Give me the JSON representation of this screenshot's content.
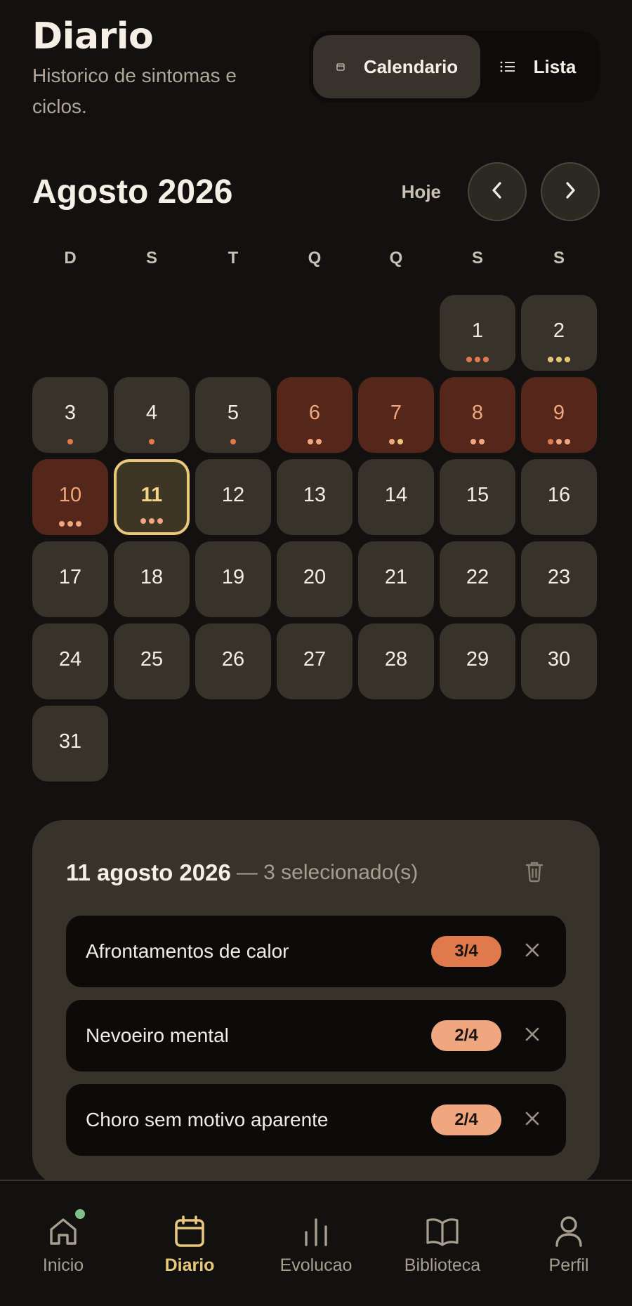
{
  "header": {
    "title": "Diario",
    "subtitle": "Historico de sintomas e ciclos."
  },
  "view_toggle": {
    "calendar_label": "Calendario",
    "list_label": "Lista",
    "active": "calendar"
  },
  "month_nav": {
    "title": "Agosto 2026",
    "today_label": "Hoje"
  },
  "weekdays": [
    "D",
    "S",
    "T",
    "Q",
    "Q",
    "S",
    "S"
  ],
  "colors": {
    "dot_orange": "#e07a4d",
    "dot_yellow": "#e9c77b",
    "dot_peach": "#f0a77f",
    "period_bg": "#54271a",
    "selected_border": "#e9c77b"
  },
  "calendar": {
    "leading_empty": 5,
    "days": [
      {
        "n": 1,
        "type": "normal",
        "dots": [
          "orange",
          "orange",
          "orange"
        ]
      },
      {
        "n": 2,
        "type": "normal",
        "dots": [
          "yellow",
          "yellow",
          "yellow"
        ]
      },
      {
        "n": 3,
        "type": "normal",
        "dots": [
          "orange"
        ]
      },
      {
        "n": 4,
        "type": "normal",
        "dots": [
          "orange"
        ]
      },
      {
        "n": 5,
        "type": "normal",
        "dots": [
          "orange"
        ]
      },
      {
        "n": 6,
        "type": "period",
        "dots": [
          "peach",
          "peach"
        ]
      },
      {
        "n": 7,
        "type": "period",
        "dots": [
          "peach",
          "yellow"
        ]
      },
      {
        "n": 8,
        "type": "period",
        "dots": [
          "peach",
          "peach"
        ]
      },
      {
        "n": 9,
        "type": "period",
        "dots": [
          "orange",
          "peach",
          "peach"
        ]
      },
      {
        "n": 10,
        "type": "period",
        "dots": [
          "peach",
          "peach",
          "peach"
        ]
      },
      {
        "n": 11,
        "type": "selected",
        "dots": [
          "peach",
          "peach",
          "peach"
        ]
      },
      {
        "n": 12,
        "type": "normal",
        "dots": []
      },
      {
        "n": 13,
        "type": "normal",
        "dots": []
      },
      {
        "n": 14,
        "type": "normal",
        "dots": []
      },
      {
        "n": 15,
        "type": "normal",
        "dots": []
      },
      {
        "n": 16,
        "type": "normal",
        "dots": []
      },
      {
        "n": 17,
        "type": "normal",
        "dots": []
      },
      {
        "n": 18,
        "type": "normal",
        "dots": []
      },
      {
        "n": 19,
        "type": "normal",
        "dots": []
      },
      {
        "n": 20,
        "type": "normal",
        "dots": []
      },
      {
        "n": 21,
        "type": "normal",
        "dots": []
      },
      {
        "n": 22,
        "type": "normal",
        "dots": []
      },
      {
        "n": 23,
        "type": "normal",
        "dots": []
      },
      {
        "n": 24,
        "type": "normal",
        "dots": []
      },
      {
        "n": 25,
        "type": "normal",
        "dots": []
      },
      {
        "n": 26,
        "type": "normal",
        "dots": []
      },
      {
        "n": 27,
        "type": "normal",
        "dots": []
      },
      {
        "n": 28,
        "type": "normal",
        "dots": []
      },
      {
        "n": 29,
        "type": "normal",
        "dots": []
      },
      {
        "n": 30,
        "type": "normal",
        "dots": []
      },
      {
        "n": 31,
        "type": "normal",
        "dots": []
      }
    ]
  },
  "selection": {
    "date": "11 agosto 2026",
    "count_text": "— 3 selecionado(s)",
    "entries": [
      {
        "label": "Afrontamentos de calor",
        "severity": "3/4",
        "badge_color": "#e07a4d"
      },
      {
        "label": "Nevoeiro mental",
        "severity": "2/4",
        "badge_color": "#f0a77f"
      },
      {
        "label": "Choro sem motivo aparente",
        "severity": "2/4",
        "badge_color": "#f0a77f"
      }
    ]
  },
  "bottom_nav": [
    {
      "label": "Inicio",
      "icon": "home-icon",
      "active": false,
      "notification": true
    },
    {
      "label": "Diario",
      "icon": "calendar-icon",
      "active": true,
      "notification": false
    },
    {
      "label": "Evolucao",
      "icon": "bar-chart-icon",
      "active": false,
      "notification": false
    },
    {
      "label": "Biblioteca",
      "icon": "book-icon",
      "active": false,
      "notification": false
    },
    {
      "label": "Perfil",
      "icon": "user-icon",
      "active": false,
      "notification": false
    }
  ]
}
